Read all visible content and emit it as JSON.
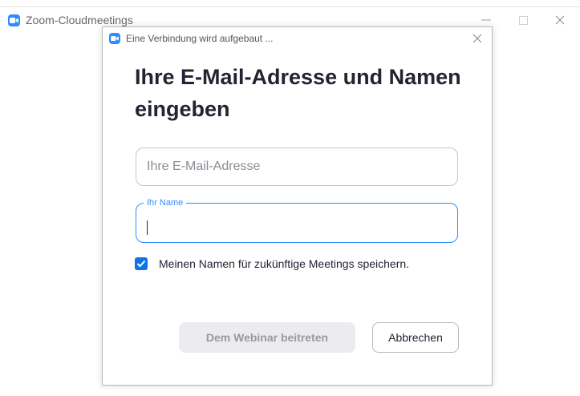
{
  "background_window": {
    "title": "Zoom-Cloudmeetings",
    "controls": [
      "minimize-icon",
      "maximize-icon",
      "close-icon"
    ]
  },
  "dialog": {
    "title": "Eine Verbindung wird aufgebaut ...",
    "heading": "Ihre E-Mail-Adresse und Namen eingeben",
    "email_field": {
      "placeholder": "Ihre E-Mail-Adresse",
      "value": ""
    },
    "name_field": {
      "label": "Ihr Name",
      "value": ""
    },
    "remember_checkbox": {
      "label": "Meinen Namen für zukünftige Meetings speichern.",
      "checked": true
    },
    "join_button": "Dem Webinar beitreten",
    "cancel_button": "Abbrechen"
  },
  "colors": {
    "accent": "#2d8cff",
    "checkbox": "#0e72ed",
    "disabled_button_bg": "#ececf0",
    "disabled_button_text": "#98989f"
  }
}
